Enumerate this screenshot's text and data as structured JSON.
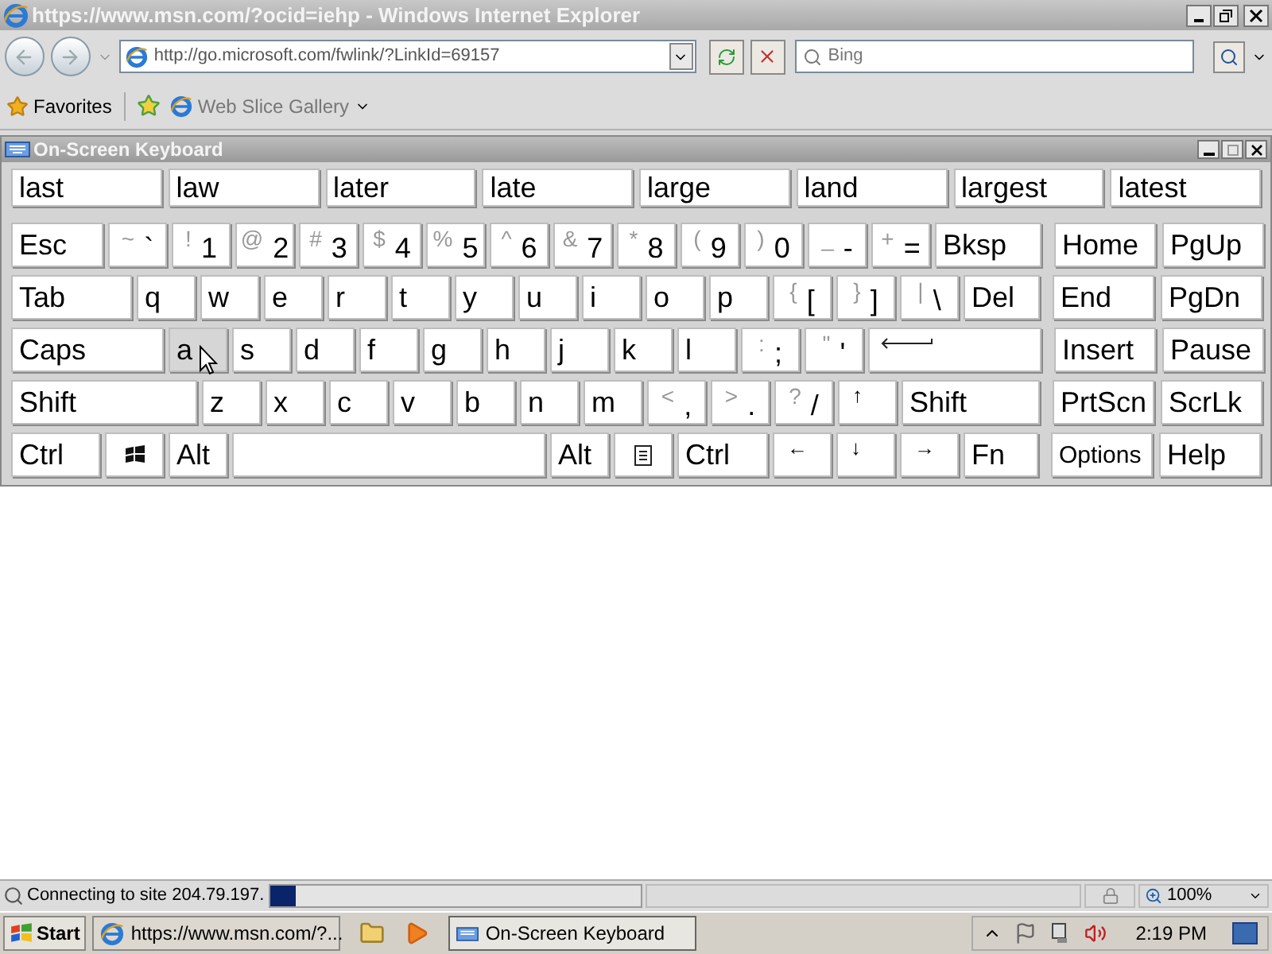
{
  "browser": {
    "title": "https://www.msn.com/?ocid=iehp - Windows Internet Explorer",
    "address": "http://go.microsoft.com/fwlink/?LinkId=69157",
    "search_placeholder": "Bing",
    "favorites": "Favorites",
    "web_slice": "Web Slice Gallery"
  },
  "keyboard": {
    "title": "On-Screen Keyboard",
    "suggestions": [
      "last",
      "law",
      "later",
      "late",
      "large",
      "land",
      "largest",
      "latest"
    ],
    "rows": [
      {
        "keys": [
          {
            "kind": "text",
            "label": "Esc",
            "hovered": false
          },
          {
            "kind": "symbol",
            "shift": "~",
            "label": "`",
            "hovered": false
          },
          {
            "kind": "symbol",
            "shift": "!",
            "label": "1",
            "hovered": false
          },
          {
            "kind": "symbol",
            "shift": "@",
            "label": "2",
            "hovered": false
          },
          {
            "kind": "symbol",
            "shift": "#",
            "label": "3",
            "hovered": false
          },
          {
            "kind": "symbol",
            "shift": "$",
            "label": "4",
            "hovered": false
          },
          {
            "kind": "symbol",
            "shift": "%",
            "label": "5",
            "hovered": false
          },
          {
            "kind": "symbol",
            "shift": "^",
            "label": "6",
            "hovered": false
          },
          {
            "kind": "symbol",
            "shift": "&",
            "label": "7",
            "hovered": false
          },
          {
            "kind": "symbol",
            "shift": "*",
            "label": "8",
            "hovered": false
          },
          {
            "kind": "symbol",
            "shift": "(",
            "label": "9",
            "hovered": false
          },
          {
            "kind": "symbol",
            "shift": ")",
            "label": "0",
            "hovered": false
          },
          {
            "kind": "symbol",
            "shift": "_",
            "label": "-",
            "hovered": false
          },
          {
            "kind": "symbol",
            "shift": "+",
            "label": "=",
            "hovered": false
          },
          {
            "kind": "text",
            "label": "Bksp",
            "hovered": false
          }
        ],
        "side": [
          {
            "kind": "text",
            "label": "Home",
            "hovered": false
          },
          {
            "kind": "text",
            "label": "PgUp",
            "hovered": false
          }
        ]
      },
      {
        "keys": [
          {
            "kind": "text",
            "label": "Tab",
            "hovered": false
          },
          {
            "kind": "text",
            "label": "q",
            "hovered": false
          },
          {
            "kind": "text",
            "label": "w",
            "hovered": false
          },
          {
            "kind": "text",
            "label": "e",
            "hovered": false
          },
          {
            "kind": "text",
            "label": "r",
            "hovered": false
          },
          {
            "kind": "text",
            "label": "t",
            "hovered": false
          },
          {
            "kind": "text",
            "label": "y",
            "hovered": false
          },
          {
            "kind": "text",
            "label": "u",
            "hovered": false
          },
          {
            "kind": "text",
            "label": "i",
            "hovered": false
          },
          {
            "kind": "text",
            "label": "o",
            "hovered": false
          },
          {
            "kind": "text",
            "label": "p",
            "hovered": false
          },
          {
            "kind": "symbol",
            "shift": "{",
            "label": "[",
            "hovered": false
          },
          {
            "kind": "symbol",
            "shift": "}",
            "label": "]",
            "hovered": false
          },
          {
            "kind": "symbol",
            "shift": "|",
            "label": "\\",
            "hovered": false
          },
          {
            "kind": "text",
            "label": "Del",
            "hovered": false
          }
        ],
        "side": [
          {
            "kind": "text",
            "label": "End",
            "hovered": false
          },
          {
            "kind": "text",
            "label": "PgDn",
            "hovered": false
          }
        ]
      },
      {
        "keys": [
          {
            "kind": "text",
            "label": "Caps",
            "hovered": false
          },
          {
            "kind": "text",
            "label": "a",
            "hovered": true
          },
          {
            "kind": "text",
            "label": "s",
            "hovered": false
          },
          {
            "kind": "text",
            "label": "d",
            "hovered": false
          },
          {
            "kind": "text",
            "label": "f",
            "hovered": false
          },
          {
            "kind": "text",
            "label": "g",
            "hovered": false
          },
          {
            "kind": "text",
            "label": "h",
            "hovered": false
          },
          {
            "kind": "text",
            "label": "j",
            "hovered": false
          },
          {
            "kind": "text",
            "label": "k",
            "hovered": false
          },
          {
            "kind": "text",
            "label": "l",
            "hovered": false
          },
          {
            "kind": "symbol",
            "shift": ":",
            "label": ";",
            "hovered": false
          },
          {
            "kind": "symbol",
            "shift": "\"",
            "label": "'",
            "hovered": false
          },
          {
            "kind": "enter",
            "hovered": false
          }
        ],
        "side": [
          {
            "kind": "text",
            "label": "Insert",
            "hovered": false
          },
          {
            "kind": "text",
            "label": "Pause",
            "hovered": false
          }
        ]
      },
      {
        "keys": [
          {
            "kind": "text",
            "label": "Shift",
            "hovered": false
          },
          {
            "kind": "text",
            "label": "z",
            "hovered": false
          },
          {
            "kind": "text",
            "label": "x",
            "hovered": false
          },
          {
            "kind": "text",
            "label": "c",
            "hovered": false
          },
          {
            "kind": "text",
            "label": "v",
            "hovered": false
          },
          {
            "kind": "text",
            "label": "b",
            "hovered": false
          },
          {
            "kind": "text",
            "label": "n",
            "hovered": false
          },
          {
            "kind": "text",
            "label": "m",
            "hovered": false
          },
          {
            "kind": "symbol",
            "shift": "<",
            "label": ",",
            "hovered": false
          },
          {
            "kind": "symbol",
            "shift": ">",
            "label": ".",
            "hovered": false
          },
          {
            "kind": "symbol",
            "shift": "?",
            "label": "/",
            "hovered": false
          },
          {
            "kind": "arrow",
            "label": "↑",
            "hovered": false
          },
          {
            "kind": "text",
            "label": "Shift",
            "hovered": false
          }
        ],
        "side": [
          {
            "kind": "text",
            "label": "PrtScn",
            "hovered": false
          },
          {
            "kind": "text",
            "label": "ScrLk",
            "hovered": false
          }
        ]
      },
      {
        "keys": [
          {
            "kind": "text",
            "label": "Ctrl",
            "hovered": false
          },
          {
            "kind": "logo",
            "hovered": false
          },
          {
            "kind": "text",
            "label": "Alt",
            "hovered": false
          },
          {
            "kind": "space",
            "hovered": false
          },
          {
            "kind": "text",
            "label": "Alt",
            "hovered": false
          },
          {
            "kind": "menu",
            "hovered": false
          },
          {
            "kind": "text",
            "label": "Ctrl",
            "hovered": false
          },
          {
            "kind": "arrow",
            "label": "←",
            "hovered": false
          },
          {
            "kind": "arrow",
            "label": "↓",
            "hovered": false
          },
          {
            "kind": "arrow",
            "label": "→",
            "hovered": false
          },
          {
            "kind": "text",
            "label": "Fn",
            "hovered": false
          }
        ],
        "side": [
          {
            "kind": "small",
            "label": "Options",
            "hovered": false
          },
          {
            "kind": "text",
            "label": "Help",
            "hovered": false
          }
        ]
      }
    ]
  },
  "status": {
    "text": "Connecting to site 204.79.197.",
    "level": 0.07,
    "zoom": "100%"
  },
  "taskbar": {
    "start": "Start",
    "tasks": [
      {
        "label": "https://www.msn.com/?...",
        "kind": "browser",
        "selected": false
      },
      {
        "label": "On-Screen Keyboard",
        "kind": "keyboard",
        "selected": true
      }
    ],
    "clock": "2:19 PM"
  }
}
